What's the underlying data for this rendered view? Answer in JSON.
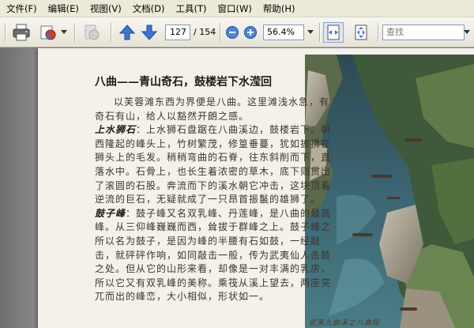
{
  "menu": [
    {
      "id": "file",
      "label": "文件(F)"
    },
    {
      "id": "edit",
      "label": "编辑(E)"
    },
    {
      "id": "view",
      "label": "视图(V)"
    },
    {
      "id": "document",
      "label": "文档(D)"
    },
    {
      "id": "tools",
      "label": "工具(T)"
    },
    {
      "id": "window",
      "label": "窗口(W)"
    },
    {
      "id": "help",
      "label": "帮助(H)"
    }
  ],
  "toolbar": {
    "page_current": "127",
    "page_total": "/ 154",
    "zoom": "56.4%",
    "find_placeholder": "查找",
    "icons": [
      "print-icon",
      "email-icon",
      "disabled-tool-icon",
      "previous-page-icon",
      "next-page-icon",
      "zoom-out-icon",
      "zoom-in-icon",
      "fit-width-icon",
      "fit-page-icon"
    ]
  },
  "article": {
    "title": "八曲——青山奇石，鼓楼岩下水滢回",
    "intro": "以芙蓉滩东西为界便是八曲。这里滩浅水急，有奇石有山，给人以豁然开朗之感。",
    "p1_lead": "上水狮石",
    "p1_body": "：上水狮石盘踞在八曲溪边，鼓楼岩下。朝西隆起的峰头上，竹树繁茂，修篁垂蔓，犹如披拂在狮头上的毛发。稍稍弯曲的石脊，往东斜削而下，直落水中。石骨上，也长生着浓密的草木，底下则贯出了滚圆的石股。奔流而下的溪水朝它冲击，这块顶着逆流的巨石，无疑就成了一只昂首振鬣的雄狮了。",
    "p2_lead": "鼓子峰",
    "p2_body": "：鼓子峰又名双乳峰、丹莲峰，是八曲的最高峰。从三仰峰巍巍而西，耸拔于群峰之上。鼓子峰之所以名为鼓子，是因为峰的半腰有石如鼓，一经敲击，就砰砰作响，如同敲击一般，传为武夷仙人击鼓之处。但从它的山形来看，却像是一对丰满的乳房，所以它又有双乳峰的美称。乘筏从溪上望去，两座突兀而出的峰峦，大小相似，形状如一。",
    "caption": "武夷九曲溪之八曲段"
  },
  "colors": {
    "menubar": "#ece9d8",
    "toolbar": "#e6e3d6",
    "workspace": "#808080",
    "paper": "#f3f1ea",
    "accent_blue": "#3a6fd0"
  }
}
